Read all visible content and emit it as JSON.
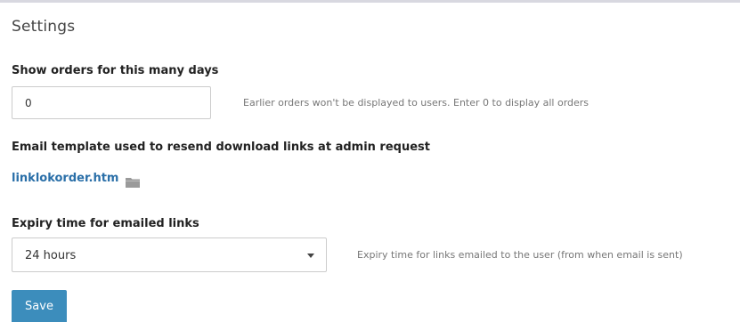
{
  "settings": {
    "title": "Settings",
    "days": {
      "label": "Show orders for this many days",
      "value": "0",
      "help": "Earlier orders won't be displayed to users. Enter 0 to display all orders"
    },
    "template": {
      "label": "Email template used to resend download links at admin request",
      "file": "linklokorder.htm",
      "icon": "folder-icon"
    },
    "expiry": {
      "label": "Expiry time for emailed links",
      "selected": "24 hours",
      "help": "Expiry time for links emailed to the user (from when email is sent)",
      "icon": "chevron-down-icon"
    },
    "save_label": "Save"
  },
  "colors": {
    "accent": "#3c8dbc",
    "link": "#2a6fa8",
    "border": "#cccccc",
    "muted_text": "#777777"
  }
}
